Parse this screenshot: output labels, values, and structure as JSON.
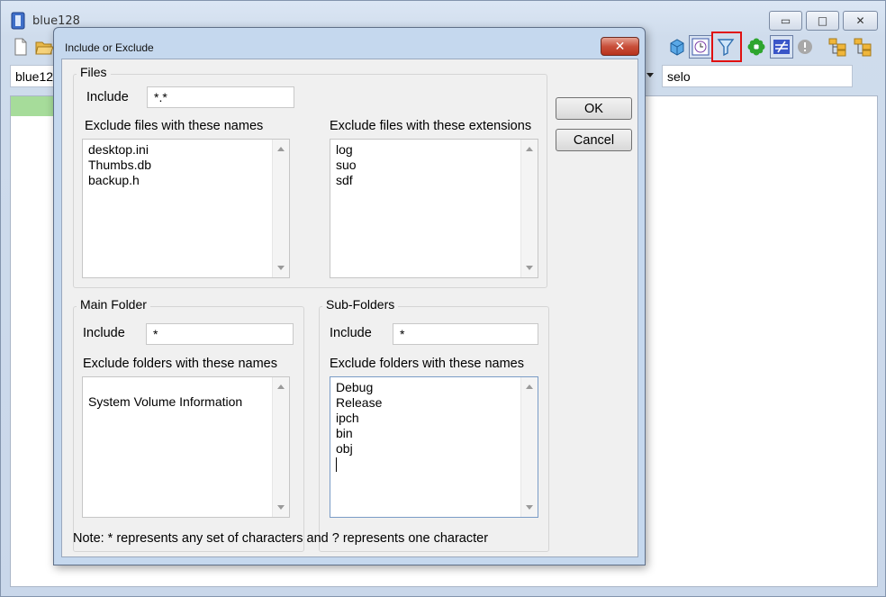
{
  "main_window": {
    "title": "blue128",
    "path_combo_value": "blue12",
    "search_value": "selo",
    "title_buttons": {
      "minimize": "▭",
      "maximize": "□",
      "close": "✕"
    },
    "toolbar_icons": [
      "new-file-icon",
      "open-folder-icon",
      "cube-icon",
      "clock-icon",
      "filter-icon",
      "flower-icon",
      "not-equal-icon",
      "info-disabled-icon",
      "folder-tree-icon",
      "folder-tree-alt-icon"
    ],
    "colors": {
      "highlight": "#e01010",
      "row_highlight": "#a6dc9a"
    }
  },
  "dialog": {
    "title": "Include or Exclude",
    "close_label": "✕",
    "ok_label": "OK",
    "cancel_label": "Cancel",
    "files": {
      "group_label": "Files",
      "include_label": "Include",
      "include_value": "*.*",
      "exclude_names_label": "Exclude files with these names",
      "exclude_names": [
        "desktop.ini",
        "Thumbs.db",
        "backup.h"
      ],
      "exclude_ext_label": "Exclude files with these extensions",
      "exclude_ext": [
        "log",
        "suo",
        "sdf"
      ]
    },
    "main_folder": {
      "group_label": "Main Folder",
      "include_label": "Include",
      "include_value": "*",
      "exclude_label": "Exclude folders with these names",
      "exclude_items": [
        "System Volume Information"
      ]
    },
    "sub_folders": {
      "group_label": "Sub-Folders",
      "include_label": "Include",
      "include_value": "*",
      "exclude_label": "Exclude folders with these names",
      "exclude_items": [
        "Debug",
        "Release",
        "ipch",
        "bin",
        "obj"
      ]
    },
    "note": "Note: * represents any set of characters and ? represents one character"
  }
}
